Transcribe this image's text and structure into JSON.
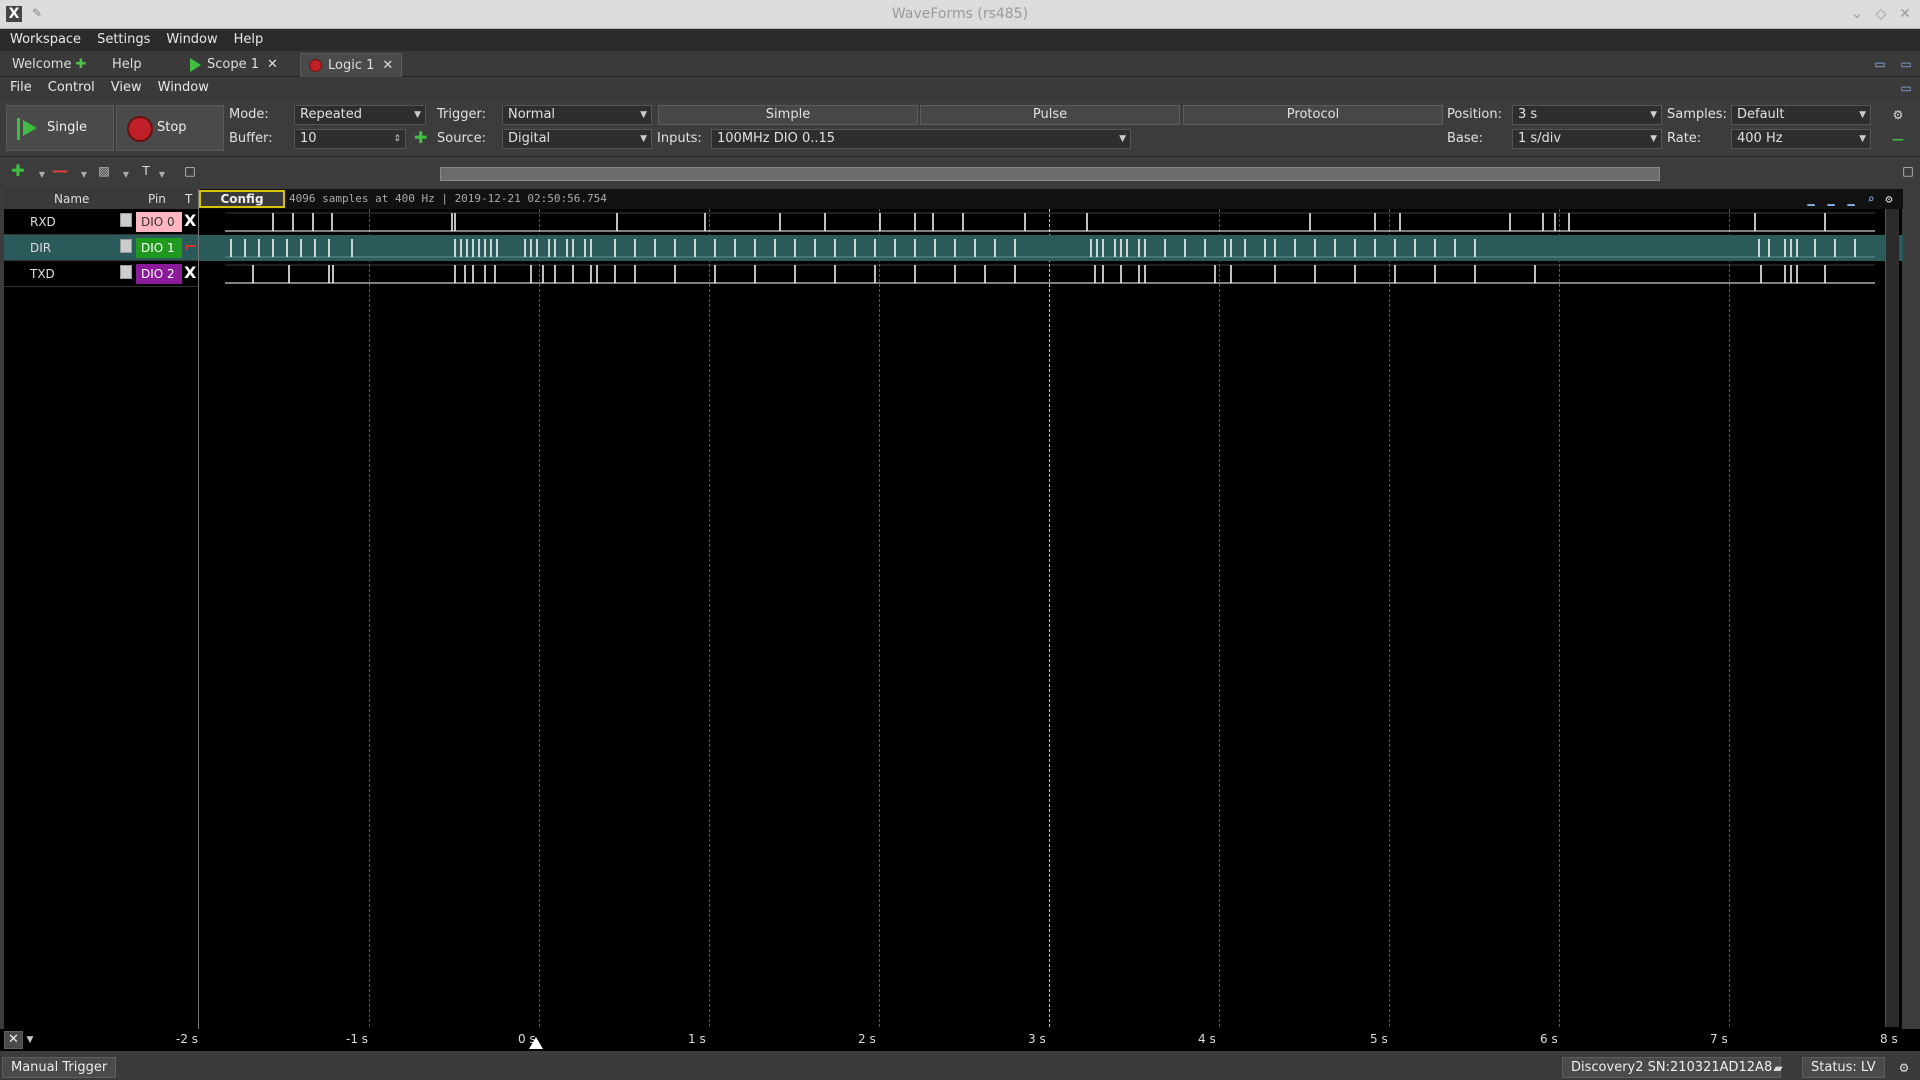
{
  "window": {
    "title": "WaveForms (rs485)"
  },
  "menu": [
    "Workspace",
    "Settings",
    "Window",
    "Help"
  ],
  "tabs": [
    {
      "label": "Welcome"
    },
    {
      "label": "Help"
    },
    {
      "label": "Scope 1"
    },
    {
      "label": "Logic 1"
    }
  ],
  "submenu": [
    "File",
    "Control",
    "View",
    "Window"
  ],
  "controls": {
    "single_label": "Single",
    "stop_label": "Stop",
    "mode_label": "Mode:",
    "mode_value": "Repeated",
    "buffer_label": "Buffer:",
    "buffer_value": "10",
    "trigger_label": "Trigger:",
    "trigger_value": "Normal",
    "source_label": "Source:",
    "source_value": "Digital",
    "simple_label": "Simple",
    "pulse_label": "Pulse",
    "protocol_label": "Protocol",
    "inputs_label": "Inputs:",
    "inputs_value": "100MHz DIO 0..15",
    "position_label": "Position:",
    "position_value": "3 s",
    "base_label": "Base:",
    "base_value": "1 s/div",
    "samples_label": "Samples:",
    "samples_value": "Default",
    "rate_label": "Rate:",
    "rate_value": "400 Hz"
  },
  "channels_header": {
    "name": "Name",
    "pin": "Pin",
    "t": "T"
  },
  "channels": [
    {
      "name": "RXD",
      "pin": "DIO 0",
      "pin_bg": "#ffb6c1",
      "pin_fg": "#333333",
      "trig": "X"
    },
    {
      "name": "DIR",
      "pin": "DIO 1",
      "pin_bg": "#1f9a1f",
      "pin_fg": "#ffffff",
      "trig": "⌐"
    },
    {
      "name": "TXD",
      "pin": "DIO 2",
      "pin_bg": "#8a1a9a",
      "pin_fg": "#ffffff",
      "trig": "X"
    }
  ],
  "plot": {
    "config_label": "Config",
    "info": "4096 samples at 400 Hz | 2019-12-21 02:50:56.754",
    "ticks": [
      "-2 s",
      "-1 s",
      "0 s",
      "1 s",
      "2 s",
      "3 s",
      "4 s",
      "5 s",
      "6 s",
      "7 s",
      "8 s"
    ]
  },
  "statusbar": {
    "manual_trigger": "Manual Trigger",
    "device": "Discovery2 SN:210321AD12A8",
    "status": "Status: LV"
  }
}
